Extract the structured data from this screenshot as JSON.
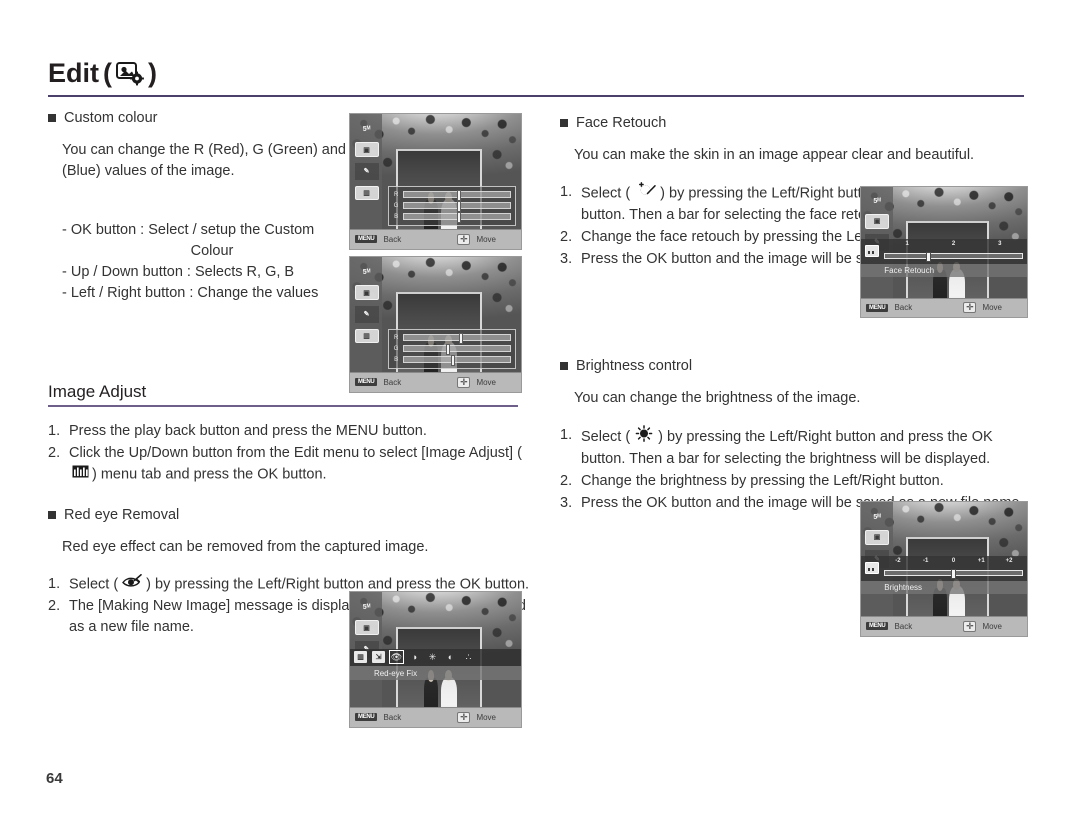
{
  "header": {
    "title": "Edit",
    "paren_open": "(",
    "paren_close": ")",
    "icon": "photo-gear-icon"
  },
  "page_number": "64",
  "left_column": {
    "custom_colour": {
      "heading": "Custom colour",
      "description": "You can change the R (Red), G (Green) and B (Blue) values of the image.",
      "button_notes": [
        "- OK button : Select / setup the Custom",
        "Colour",
        "- Up / Down button  : Selects R, G, B",
        "- Left / Right button  : Change the values"
      ]
    },
    "image_adjust": {
      "section_title": "Image Adjust",
      "steps": [
        {
          "num": "1.",
          "text": "Press the play back button and press the MENU button."
        },
        {
          "num": "2.",
          "text_before": "Click the Up/Down button from the Edit menu to select [Image Adjust] (",
          "icon": "image-adjust-icon",
          "text_after": ") menu tab and press the OK button."
        }
      ]
    },
    "red_eye": {
      "heading": "Red eye Removal",
      "description": "Red eye effect can be removed from the captured image.",
      "steps": [
        {
          "num": "1.",
          "text_before": "Select (",
          "icon": "red-eye-icon",
          "text_after": ") by pressing the Left/Right button and press the OK button."
        },
        {
          "num": "2.",
          "text_before": "The [Making New Image] message is displayed and the image is saved as a new file name.",
          "icon": "",
          "text_after": ""
        }
      ]
    }
  },
  "right_column": {
    "face_retouch": {
      "heading": "Face Retouch",
      "description": "You can make the skin in an image appear clear and beautiful.",
      "steps": [
        {
          "num": "1.",
          "text_before": "Select (",
          "icon": "face-retouch-icon",
          "text_after": ") by pressing the Left/Right button and press the OK button. Then a bar for selecting the face retouch will be displayed."
        },
        {
          "num": "2.",
          "text_before": "Change the face retouch by pressing the Left/Right button.",
          "icon": "",
          "text_after": ""
        },
        {
          "num": "3.",
          "text_before": "Press the OK button and the image will be saved as a new file name.",
          "icon": "",
          "text_after": ""
        }
      ]
    },
    "brightness": {
      "heading": "Brightness control",
      "description": "You can change the brightness of the image.",
      "steps": [
        {
          "num": "1.",
          "text_before": "Select (",
          "icon": "brightness-icon",
          "text_after": ") by pressing the Left/Right button and press the OK button. Then a bar for selecting the brightness will be displayed."
        },
        {
          "num": "2.",
          "text_before": "Change the brightness by pressing the Left/Right button.",
          "icon": "",
          "text_after": ""
        },
        {
          "num": "3.",
          "text_before": "Press the OK button and the image will be saved as a new file name.",
          "icon": "",
          "text_after": ""
        }
      ]
    }
  },
  "lcd_screens": {
    "common": {
      "back_key": "MENU",
      "back_label": "Back",
      "move_label": "Move",
      "resolution": "5ᴹ",
      "strip_icons": [
        "resolution-5m",
        "photo-icon",
        "pen-icon",
        "image-adjust-icon"
      ]
    },
    "custom_colour_1": {
      "rgb_labels": [
        "R",
        "G",
        "B"
      ],
      "rgb_values": [
        50,
        50,
        50
      ]
    },
    "custom_colour_2": {
      "rgb_labels": [
        "R",
        "G",
        "B"
      ],
      "rgb_values": [
        52,
        40,
        45
      ]
    },
    "face_retouch": {
      "ticks": [
        "1",
        "2",
        "3"
      ],
      "name": "Face Retouch",
      "knob_percent": 33
    },
    "brightness": {
      "ticks": [
        "-2",
        "-1",
        "0",
        "+1",
        "+2"
      ],
      "name": "Brightness",
      "knob_percent": 50
    },
    "red_eye_fix": {
      "name": "Red-eye Fix",
      "menu_icons": [
        "image-adjust-icon",
        "resize-icon",
        "red-eye-icon",
        "face-retouch-icon",
        "brightness-icon",
        "contrast-icon",
        "saturation-icon"
      ],
      "active_index": 2
    }
  }
}
